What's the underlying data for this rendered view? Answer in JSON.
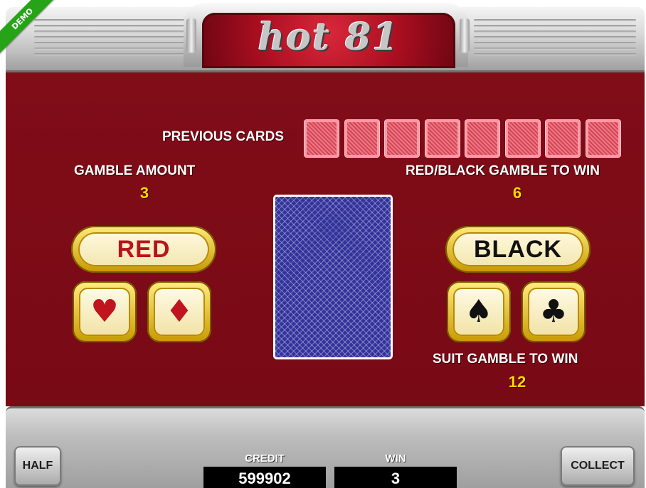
{
  "header": {
    "logo_text": "hot 81",
    "demo_badge": "DEMO"
  },
  "gamble": {
    "previous_cards_label": "PREVIOUS CARDS",
    "previous_cards_count": 8,
    "gamble_amount_label": "GAMBLE AMOUNT",
    "gamble_amount_value": "3",
    "red_black_label": "RED/BLACK GAMBLE TO WIN",
    "red_black_value": "6",
    "suit_label": "SUIT GAMBLE TO WIN",
    "suit_value": "12",
    "red_button": "RED",
    "black_button": "BLACK",
    "suits": {
      "hearts": "♥",
      "diamonds": "♦",
      "spades": "♠",
      "clubs": "♣"
    },
    "colors": {
      "red_text": "#b8141e",
      "black_text": "#111111",
      "value_yellow": "#ffd400",
      "background": "#7e0c17"
    }
  },
  "footer": {
    "half_button": "HALF",
    "collect_button": "COLLECT",
    "credit_label": "CREDIT",
    "credit_value": "599902",
    "win_label": "WIN",
    "win_value": "3"
  }
}
